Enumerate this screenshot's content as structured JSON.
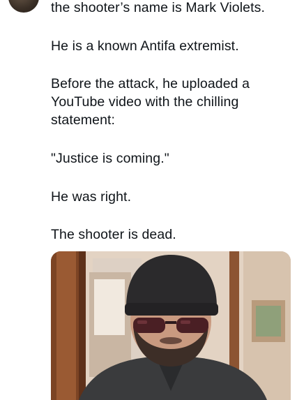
{
  "post": {
    "paragraphs": [
      "the shooter’s name is Mark Violets.",
      "He is a known Antifa extremist.",
      "Before the attack, he uploaded a YouTube video with the chilling statement:",
      "\"Justice is coming.\"",
      "He was right.",
      "The shooter is dead."
    ],
    "media": {
      "kind": "photo",
      "colors": {
        "wall": "#e6d8c9",
        "door_frame": "#8a4e2a",
        "beanie": "#2b2a2c",
        "jacket": "#3b3c3e",
        "skin": "#c99a80",
        "sunglasses": "#4a1f24"
      }
    }
  }
}
